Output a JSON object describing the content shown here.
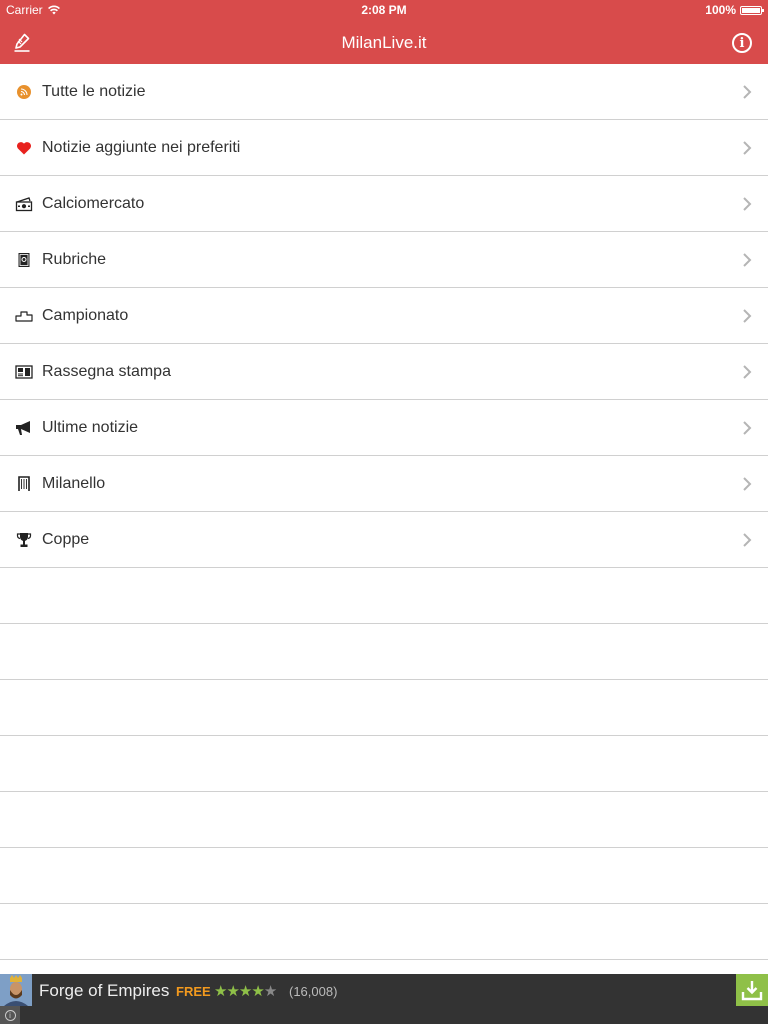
{
  "status_bar": {
    "carrier": "Carrier",
    "time": "2:08 PM",
    "battery": "100%"
  },
  "nav": {
    "title": "MilanLive.it",
    "left_icon": "pencil-icon",
    "right_icon": "info-icon"
  },
  "menu": [
    {
      "label": "Tutte le notizie",
      "icon": "rss-icon",
      "color": "#e8912d"
    },
    {
      "label": "Notizie aggiunte nei preferiti",
      "icon": "heart-icon",
      "color": "#e8221e"
    },
    {
      "label": "Calciomercato",
      "icon": "money-icon"
    },
    {
      "label": "Rubriche",
      "icon": "book-icon"
    },
    {
      "label": "Campionato",
      "icon": "podium-icon"
    },
    {
      "label": "Rassegna stampa",
      "icon": "newspaper-icon"
    },
    {
      "label": "Ultime notizie",
      "icon": "megaphone-icon"
    },
    {
      "label": "Milanello",
      "icon": "goalpost-icon"
    },
    {
      "label": "Coppe",
      "icon": "trophy-icon"
    }
  ],
  "ad": {
    "title": "Forge of Empires",
    "price": "FREE",
    "rating": 4,
    "count": "(16,008)"
  },
  "colors": {
    "header": "#d84b4b",
    "accent_green": "#8fc048",
    "free": "#f39a1e"
  }
}
